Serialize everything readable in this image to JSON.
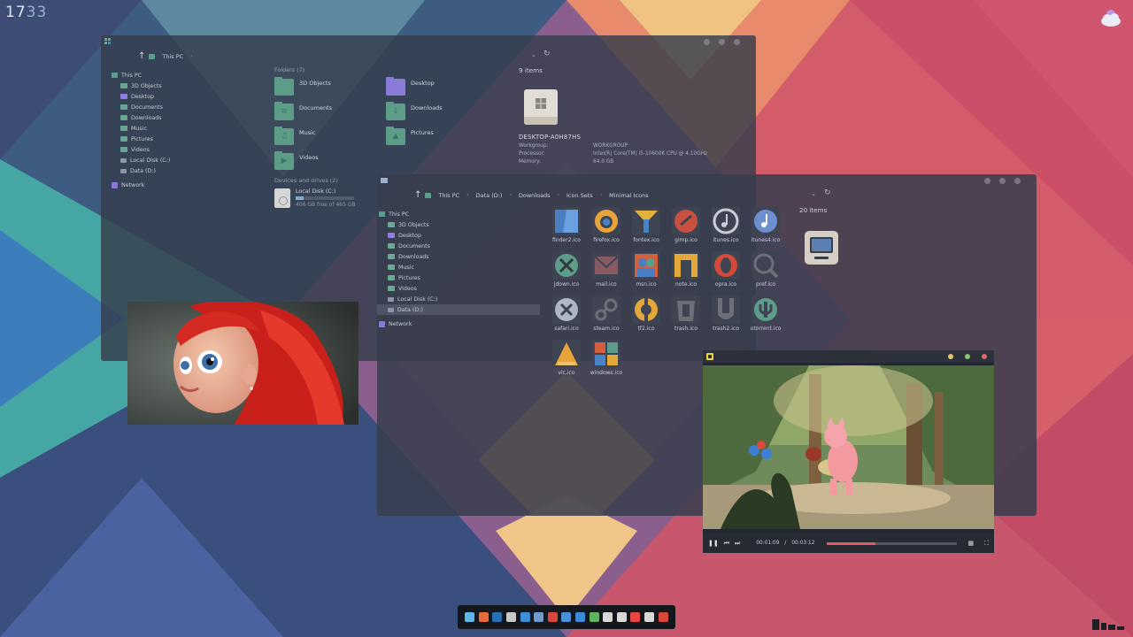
{
  "clock": {
    "hours": "17",
    "minutes": "33"
  },
  "explorer_pc": {
    "breadcrumb": [
      "This PC"
    ],
    "sidebar": [
      {
        "label": "This PC",
        "type": "pc",
        "root": true
      },
      {
        "label": "3D Objects",
        "type": "folder"
      },
      {
        "label": "Desktop",
        "type": "folder-purple"
      },
      {
        "label": "Documents",
        "type": "folder"
      },
      {
        "label": "Downloads",
        "type": "folder"
      },
      {
        "label": "Music",
        "type": "folder"
      },
      {
        "label": "Pictures",
        "type": "folder"
      },
      {
        "label": "Videos",
        "type": "folder"
      },
      {
        "label": "Local Disk (C:)",
        "type": "disk"
      },
      {
        "label": "Data (D:)",
        "type": "disk"
      },
      {
        "label": "Network",
        "type": "network",
        "root": true
      }
    ],
    "folders_title": "Folders (7)",
    "folders": [
      {
        "label": "3D Objects",
        "glyph": "",
        "purple": false
      },
      {
        "label": "Desktop",
        "glyph": "",
        "purple": true
      },
      {
        "label": "Documents",
        "glyph": "≡",
        "purple": false
      },
      {
        "label": "Downloads",
        "glyph": "↓",
        "purple": false
      },
      {
        "label": "Music",
        "glyph": "♫",
        "purple": false
      },
      {
        "label": "Pictures",
        "glyph": "▲",
        "purple": false
      },
      {
        "label": "Videos",
        "glyph": "▶",
        "purple": false
      }
    ],
    "drives_title": "Devices and drives (2)",
    "drive": {
      "label": "Local Disk (C:)",
      "free": "406 GB free of 465 GB",
      "used_fraction": 0.13
    },
    "items_count": "9 items",
    "pc_name": "DESKTOP-A0H87HS",
    "pc_props": [
      {
        "k": "Workgroup:",
        "v": "WORKGROUP"
      },
      {
        "k": "Processor:",
        "v": "Intel(R) Core(TM) i5-10600K CPU @ 4.10GHz"
      },
      {
        "k": "Memory:",
        "v": "64.0 GB"
      }
    ]
  },
  "explorer_icons": {
    "breadcrumb": [
      "This PC",
      "Data (D:)",
      "Downloads",
      "Icon Sets",
      "Minimal Icons"
    ],
    "sidebar": [
      {
        "label": "This PC",
        "type": "pc",
        "root": true
      },
      {
        "label": "3D Objects",
        "type": "folder"
      },
      {
        "label": "Desktop",
        "type": "folder-purple"
      },
      {
        "label": "Documents",
        "type": "folder"
      },
      {
        "label": "Downloads",
        "type": "folder"
      },
      {
        "label": "Music",
        "type": "folder"
      },
      {
        "label": "Pictures",
        "type": "folder"
      },
      {
        "label": "Videos",
        "type": "folder"
      },
      {
        "label": "Local Disk (C:)",
        "type": "disk"
      },
      {
        "label": "Data (D:)",
        "type": "disk",
        "selected": true
      },
      {
        "label": "Network",
        "type": "network",
        "root": true
      }
    ],
    "items_count": "20 items",
    "icons": [
      {
        "label": "finder2.ico",
        "color": "#4a7fc4",
        "shape": "finder"
      },
      {
        "label": "firefox.ico",
        "color": "#e8a33a",
        "shape": "ring"
      },
      {
        "label": "fontex.ico",
        "color": "#e3b23c",
        "shape": "fontex"
      },
      {
        "label": "gimp.ico",
        "color": "#c9503f",
        "shape": "gimp"
      },
      {
        "label": "itunes.ico",
        "color": "#c8ccd6",
        "shape": "note-ring"
      },
      {
        "label": "itunes4.ico",
        "color": "#6d8fd0",
        "shape": "note-solid"
      },
      {
        "label": "jdown.ico",
        "color": "#5e9c8c",
        "shape": "jdown"
      },
      {
        "label": "mail.ico",
        "color": "#8a5a63",
        "shape": "mail"
      },
      {
        "label": "msn.ico",
        "color": "#4a7fc4",
        "shape": "msn"
      },
      {
        "label": "note.ico",
        "color": "#e3a83a",
        "shape": "note"
      },
      {
        "label": "opra.ico",
        "color": "#d44a3a",
        "shape": "opera"
      },
      {
        "label": "pref.ico",
        "color": "#6c6f78",
        "shape": "pref"
      },
      {
        "label": "safari.ico",
        "color": "#aeb7c7",
        "shape": "safari"
      },
      {
        "label": "steam.ico",
        "color": "#6c6f78",
        "shape": "steam"
      },
      {
        "label": "tf2.ico",
        "color": "#e3a83a",
        "shape": "tf2"
      },
      {
        "label": "trash.ico",
        "color": "#6c6f78",
        "shape": "trash"
      },
      {
        "label": "trash2.ico",
        "color": "#6c6f78",
        "shape": "trash2"
      },
      {
        "label": "utorrent.ico",
        "color": "#5e9c8c",
        "shape": "utorrent"
      },
      {
        "label": "vlc.ico",
        "color": "#e8a33a",
        "shape": "vlc"
      },
      {
        "label": "windows.ico",
        "color": "#d45f3f",
        "shape": "windows"
      }
    ]
  },
  "player": {
    "current": "00:01:09",
    "separator": "/",
    "total": "00:03:12",
    "progress_fraction": 0.37
  },
  "dock_items": [
    {
      "name": "finder-dock-icon",
      "color": "#5fb7e8"
    },
    {
      "name": "firefox-dock-icon",
      "color": "#e86a3a"
    },
    {
      "name": "photoshop-dock-icon",
      "color": "#2b6fb3"
    },
    {
      "name": "itunes-dock-icon",
      "color": "#c8c8c8"
    },
    {
      "name": "mail-dock-icon",
      "color": "#3e8fd6"
    },
    {
      "name": "display-dock-icon",
      "color": "#6f9ccf"
    },
    {
      "name": "opera-dock-icon",
      "color": "#d9463a"
    },
    {
      "name": "settings-dock-icon",
      "color": "#4a90d9"
    },
    {
      "name": "app-store-dock-icon",
      "color": "#3b8ad9"
    },
    {
      "name": "download-dock-icon",
      "color": "#5fb35f"
    },
    {
      "name": "search-dock-icon",
      "color": "#d8d8d8"
    },
    {
      "name": "volume-dock-icon",
      "color": "#d8d8d8"
    },
    {
      "name": "document-dock-icon",
      "color": "#e84545"
    },
    {
      "name": "trash-dock-icon",
      "color": "#d8d8d8"
    },
    {
      "name": "power-dock-icon",
      "color": "#d9463a"
    }
  ]
}
